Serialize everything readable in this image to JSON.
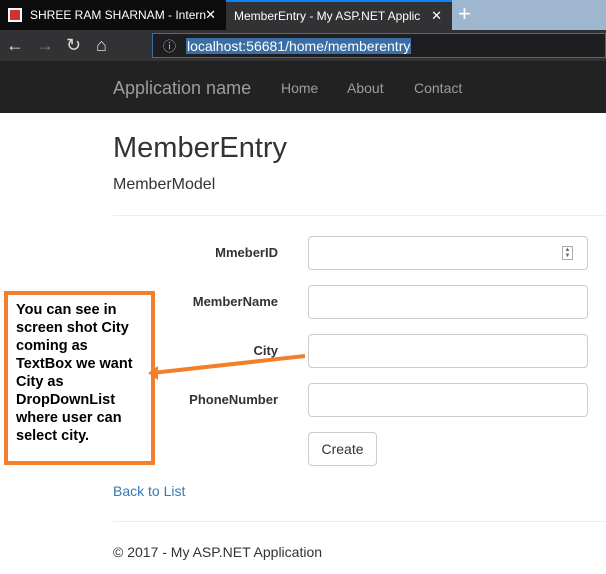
{
  "browser": {
    "tabs": [
      {
        "title": "SHREE RAM SHARNAM - Intern",
        "active": false
      },
      {
        "title": "MemberEntry - My ASP.NET Applic",
        "active": true
      }
    ],
    "new_tab": "+",
    "close": "✕",
    "url": "localhost:56681/home/memberentry"
  },
  "nav": {
    "brand": "Application name",
    "links": [
      "Home",
      "About",
      "Contact"
    ]
  },
  "page": {
    "title": "MemberEntry",
    "subtitle": "MemberModel"
  },
  "form": {
    "fields": [
      {
        "label": "MmeberID",
        "value": ""
      },
      {
        "label": "MemberName",
        "value": ""
      },
      {
        "label": "City",
        "value": ""
      },
      {
        "label": "PhoneNumber",
        "value": ""
      }
    ],
    "submit": "Create"
  },
  "back_link": "Back to List",
  "footer": "© 2017 - My ASP.NET Application",
  "annotation": {
    "text": "You can see in screen shot City coming as TextBox we want City as DropDownList where user can select city.",
    "color": "#f47f2a"
  }
}
